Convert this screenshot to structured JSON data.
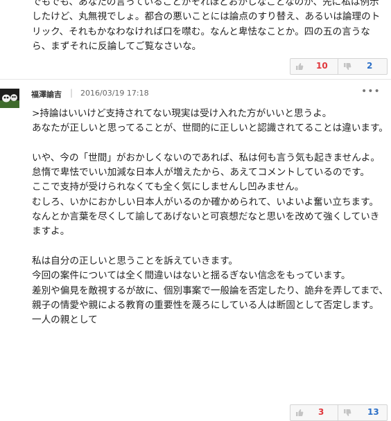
{
  "comment1": {
    "text": "でもでも、あなたの言っていることがそれほどおかしなことなのか、先に私は例示したけど、丸無視でしょ。都合の悪いことには論点のすり替え、あるいは論理のトリック、それもかなわなければ口を噤む。なんと卑怯なことか。四の五の言うなら、まずそれに反論してご覧なさいな。",
    "likes": "10",
    "dislikes": "2"
  },
  "comment2": {
    "author": "福澤諭吉",
    "separator": "|",
    "date": "2016/03/19 17:18",
    "more": "•••",
    "text": ">持論はいいけど支持されてない現実は受け入れた方がいいと思うよ。\nあなたが正しいと思ってることが、世間的に正しいと認識されてることは違います。\n\nいや、今の「世間」がおかしくないのであれば、私は何も言う気も起きませんよ。\n怠惰で卑怯でいい加減な日本人が増えたから、あえてコメントしているのです。\nここで支持が受けられなくても全く気にしませんし凹みません。\nむしろ、いかにおかしい日本人がいるのか確かめられて、いよいよ奮い立ちます。\nなんとか言葉を尽くして諭してあげないと可哀想だなと思いを改めて強くしていきますよ。\n\n私は自分の正しいと思うことを訴えていきます。\n今回の案件については全く間違いはないと揺るぎない信念をもっています。\n差別や偏見を敵視するが故に、個別事案で一般論を否定したり、詭弁を弄してまで、親子の情愛や親による教育の重要性を蔑ろにしている人は断固として否定します。\n一人の親として",
    "likes": "3",
    "dislikes": "13"
  },
  "colors": {
    "like": "#e0373c",
    "dislike": "#2c6fc7",
    "icon": "#c4c4c4"
  },
  "icons": {
    "like": "thumbs-up-icon",
    "dislike": "thumbs-down-icon",
    "more": "more-options-icon"
  }
}
